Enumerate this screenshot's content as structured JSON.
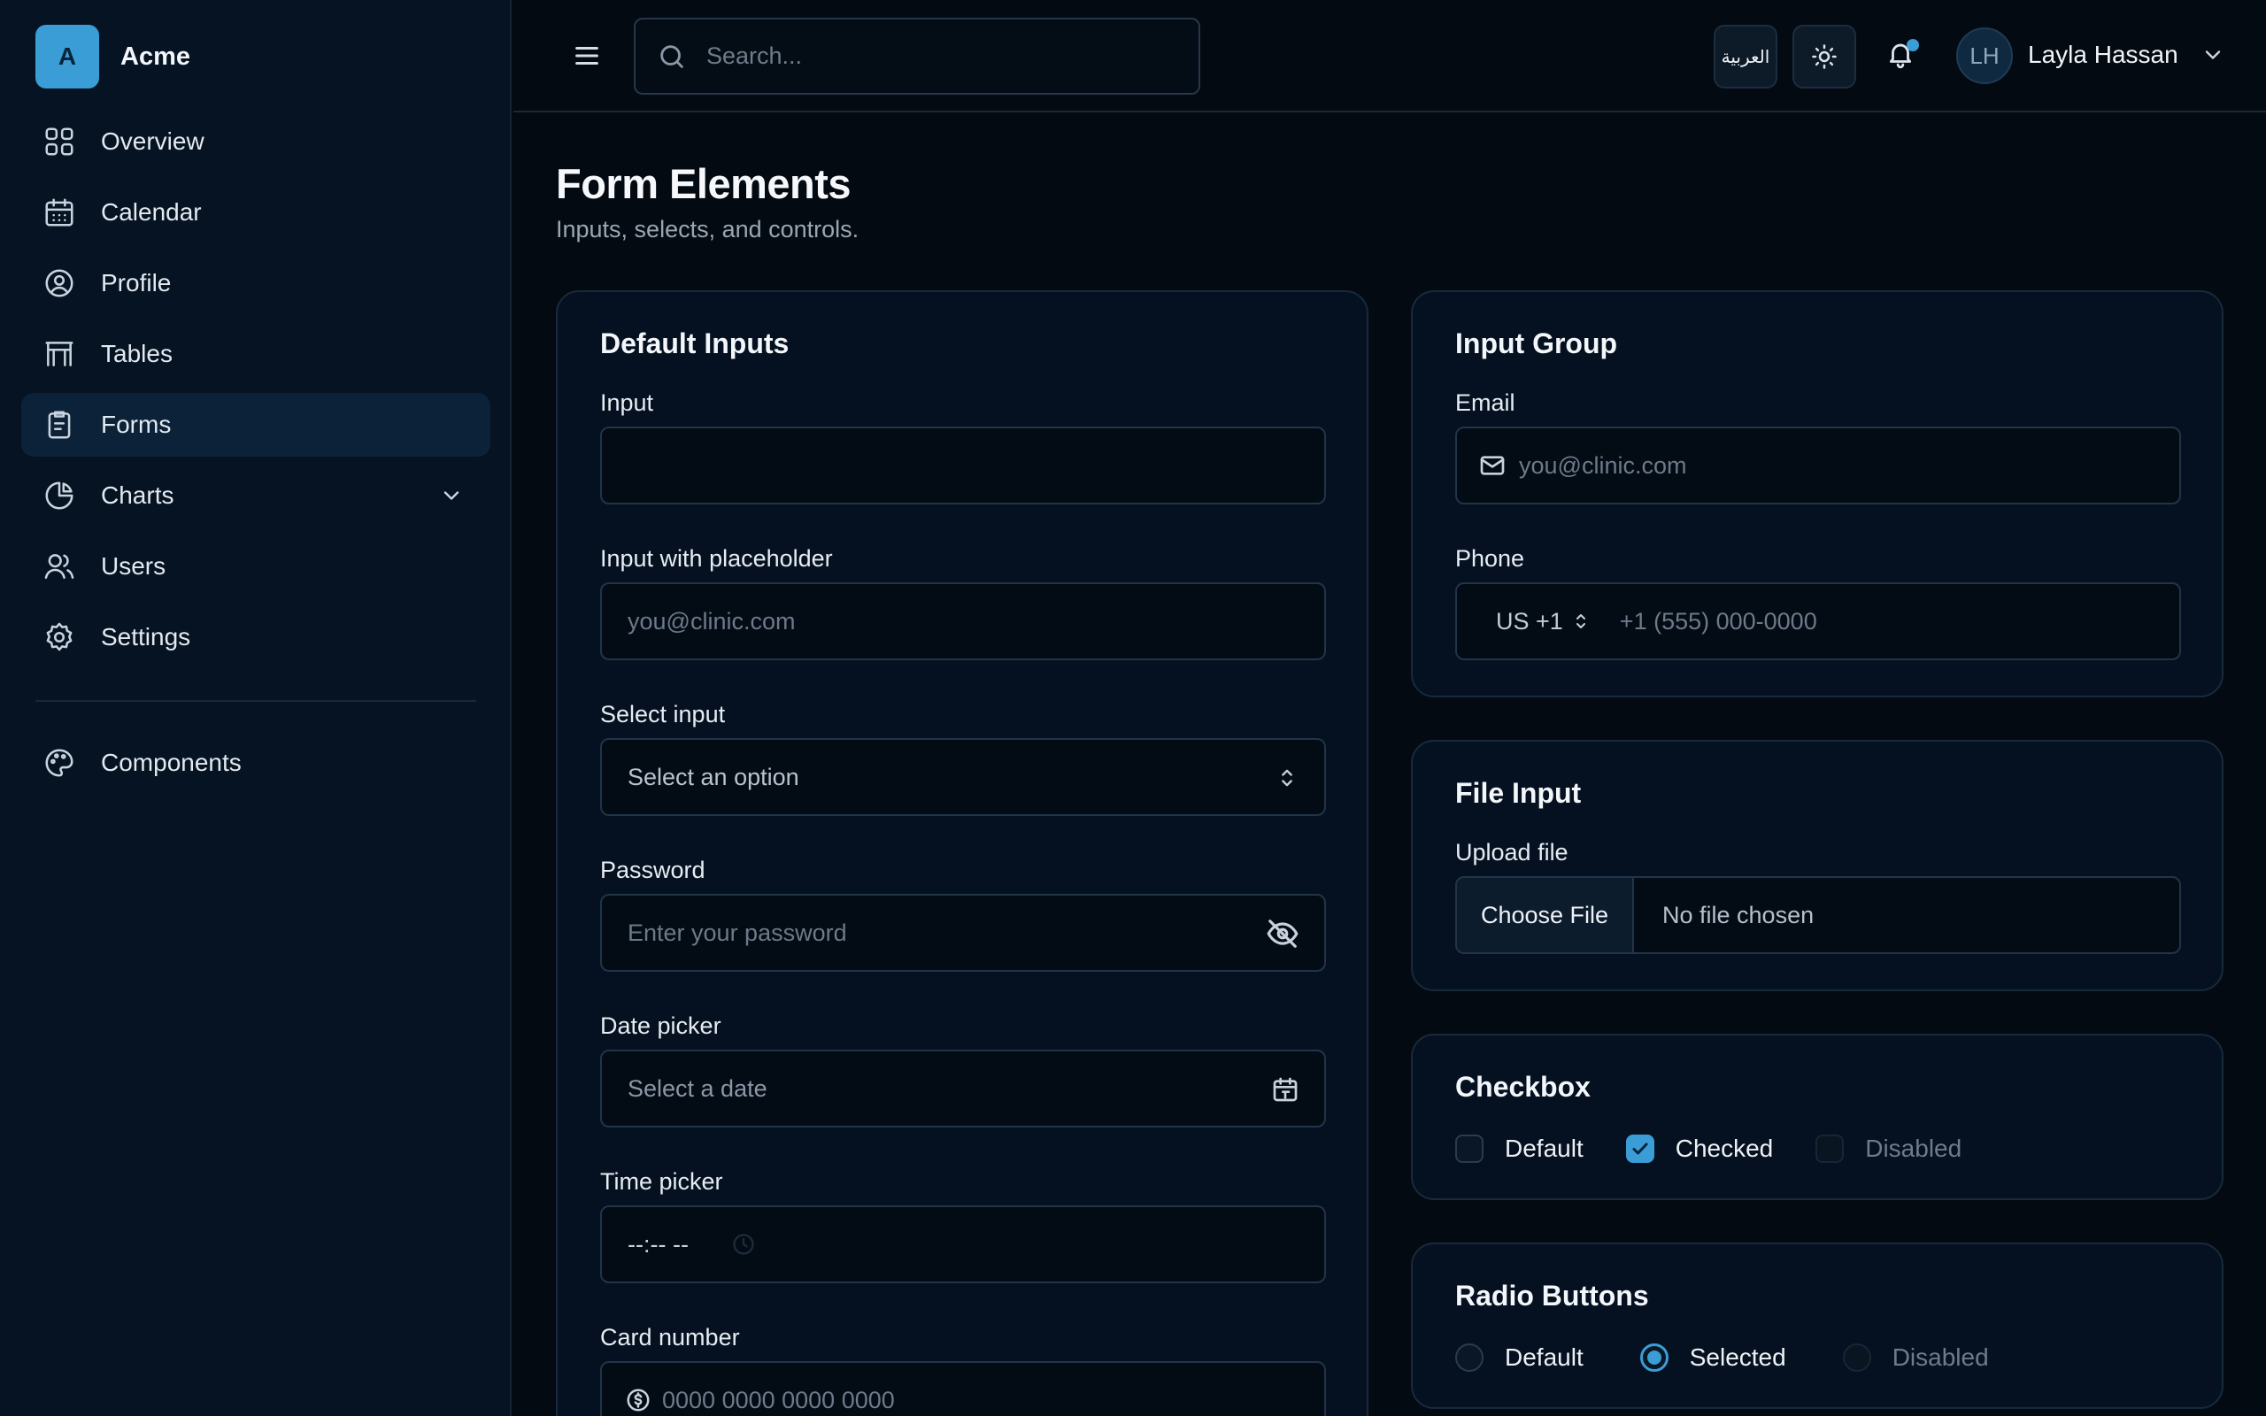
{
  "brand": {
    "initial": "A",
    "name": "Acme"
  },
  "sidebar": {
    "items": [
      {
        "label": "Overview",
        "icon": "grid-icon"
      },
      {
        "label": "Calendar",
        "icon": "calendar-icon"
      },
      {
        "label": "Profile",
        "icon": "user-circle-icon"
      },
      {
        "label": "Tables",
        "icon": "table-icon"
      },
      {
        "label": "Forms",
        "icon": "clipboard-icon",
        "active": true
      },
      {
        "label": "Charts",
        "icon": "pie-chart-icon",
        "expandable": true
      },
      {
        "label": "Users",
        "icon": "users-icon"
      },
      {
        "label": "Settings",
        "icon": "gear-icon"
      }
    ],
    "secondary": [
      {
        "label": "Components",
        "icon": "palette-icon"
      }
    ]
  },
  "topbar": {
    "search_placeholder": "Search...",
    "language_label": "العربية",
    "user": {
      "initials": "LH",
      "name": "Layla Hassan"
    }
  },
  "page": {
    "title": "Form Elements",
    "subtitle": "Inputs, selects, and controls."
  },
  "default_inputs": {
    "title": "Default Inputs",
    "input": {
      "label": "Input",
      "value": ""
    },
    "input_placeholder": {
      "label": "Input with placeholder",
      "placeholder": "you@clinic.com"
    },
    "select": {
      "label": "Select input",
      "value": "Select an option"
    },
    "password": {
      "label": "Password",
      "placeholder": "Enter your password"
    },
    "date": {
      "label": "Date picker",
      "placeholder": "Select a date"
    },
    "time": {
      "label": "Time picker",
      "value": "--:-- --"
    },
    "card": {
      "label": "Card number",
      "placeholder": "0000 0000 0000 0000"
    }
  },
  "input_group": {
    "title": "Input Group",
    "email": {
      "label": "Email",
      "placeholder": "you@clinic.com"
    },
    "phone": {
      "label": "Phone",
      "country": "US +1",
      "placeholder": "+1 (555) 000-0000"
    }
  },
  "file_input": {
    "title": "File Input",
    "label": "Upload file",
    "button": "Choose File",
    "status": "No file chosen"
  },
  "checkbox": {
    "title": "Checkbox",
    "options": [
      {
        "label": "Default",
        "state": "unchecked"
      },
      {
        "label": "Checked",
        "state": "checked"
      },
      {
        "label": "Disabled",
        "state": "disabled"
      }
    ]
  },
  "radio": {
    "title": "Radio Buttons",
    "options": [
      {
        "label": "Default",
        "state": "unselected"
      },
      {
        "label": "Selected",
        "state": "selected"
      },
      {
        "label": "Disabled",
        "state": "disabled"
      }
    ]
  },
  "colors": {
    "accent": "#3a9dd6",
    "background": "#030a12",
    "sidebar": "#051322",
    "card": "#051120"
  }
}
